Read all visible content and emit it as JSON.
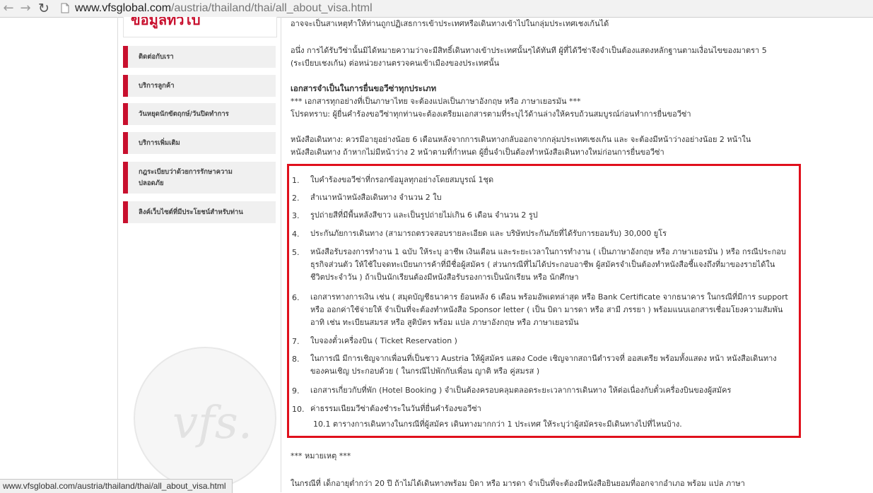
{
  "browser": {
    "url_host": "www.vfsglobal.com",
    "url_path": "/austria/thailand/thai/all_about_visa.html",
    "status_url": "www.vfsglobal.com/austria/thailand/thai/all_about_visa.html"
  },
  "sidebar": {
    "header": "ข้อมูลทั่วไป",
    "items": [
      {
        "label": "ติดต่อกับเรา"
      },
      {
        "label": "บริการลูกค้า"
      },
      {
        "label": "วันหยุดนักขัตฤกษ์/วันปิดทำการ"
      },
      {
        "label": "บริการเพิ่มเติม"
      },
      {
        "label_line1": "กฎระเบียบว่าด้วยการรักษาความ",
        "label_line2": "ปลอดภัย"
      },
      {
        "label": "ลิงค์เว็บไซต์ที่มีประโยชน์สำหรับท่าน"
      }
    ],
    "watermark": "vfs."
  },
  "main": {
    "top_line": "อาจจะเป็นสาเหตุทำให้ท่านถูกปฏิเสธการเข้าประเทศหรือเดินทางเข้าไปในกลุ่มประเทศเชงเก้นได้",
    "para1_line1": "อนึ่ง การได้รับวีซ่านั้นมิได้หมายความว่าจะมีสิทธิ์เดินทางเข้าประเทศนั้นๆได้ทันที ผู้ที่ได้วีซ่าจึงจำเป็นต้องแสดงหลักฐานตามเงื่อนไขของมาตรา 5",
    "para1_line2": "(ระเบียบเชงเก้น) ต่อหน่วยงานตรวจคนเข้าเมืองของประเทศนั้น",
    "section_title": "เอกสารจำเป็นในการยื่นขอวีซ่าทุกประเภท",
    "note_line1": "*** เอกสารทุกอย่างที่เป็นภาษาไทย จะต้องแปลเป็นภาษาอังกฤษ หรือ ภาษาเยอรมัน ***",
    "note_line2": "โปรดทราบ: ผู้ยื่นคำร้องขอวีซ่าทุกท่านจะต้องเตรียมเอกสารตามที่ระบุไว้ด้านล่างให้ครบถ้วนสมบูรณ์ก่อนทำการยื่นขอวีซ่า",
    "passport_line1": "หนังสือเดินทาง: ควรมีอายุอย่างน้อย 6 เดือนหลังจากการเดินทางกลับออกจากกลุ่มประเทศเชงเก้น และ จะต้องมีหน้าว่างอย่างน้อย 2 หน้าใน",
    "passport_line2": "หนังสือเดินทาง ถ้าหากไม่มีหน้าว่าง 2 หน้าตามที่กำหนด ผู้ยื่นจำเป็นต้องทำหนังสือเดินทางใหม่ก่อนการยื่นขอวีซ่า",
    "list": [
      {
        "num": "1.",
        "lines": [
          "ใบคำร้องขอวีซ่าที่กรอกข้อมูลทุกอย่างโดยสมบูรณ์ 1ชุด"
        ]
      },
      {
        "num": "2.",
        "lines": [
          "สำเนาหน้าหนังสือเดินทาง จำนวน 2 ใบ"
        ]
      },
      {
        "num": "3.",
        "lines": [
          "รูปถ่ายสีที่มีพื้นหลังสีขาว และเป็นรูปถ่ายไม่เกิน 6 เดือน จำนวน 2 รูป"
        ]
      },
      {
        "num": "4.",
        "lines": [
          "ประกันภัยการเดินทาง (สามารถตรวจสอบรายละเอียด และ บริษัทประกันภัยที่ได้รับการยอมรับ) 30,000 ยูโร"
        ]
      },
      {
        "num": "5.",
        "lines": [
          "หนังสือรับรองการทำงาน 1 ฉบับ ให้ระบุ อาชีพ เงินเดือน และระยะเวลาในการทำงาน ( เป็นภาษาอังกฤษ หรือ ภาษาเยอรมัน ) หรือ กรณีประกอบ",
          "ธุรกิจส่วนตัว ให้ใช้ใบจดทะเบียนการค้าที่มีชื่อผู้สมัคร ( ส่วนกรณีที่ไม่ได้ประกอบอาชีพ ผู้สมัครจำเป็นต้องทำหนังสือชี้แจงถึงที่มาของรายได้ใน",
          "ชีวิตประจำวัน ) ถ้าเป็นนักเรียนต้องมีหนังสือรับรองการเป็นนักเรียน หรือ นักศึกษา"
        ]
      },
      {
        "num": "6.",
        "lines": [
          "เอกสารทางการเงิน เช่น ( สมุดบัญชีธนาคาร ย้อนหลัง 6 เดือน พร้อมอัพเดทล่าสุด หรือ Bank Certificate จากธนาคาร ในกรณีที่มีการ support",
          "หรือ ออกค่าใช้จ่ายให้ จำเป็นที่จะต้องทำหนังสือ Sponsor letter ( เป็น บิดา มารดา หรือ สามี ภรรยา ) พร้อมแนบเอกสารเชื่อมโยงความสัมพัน",
          "อาทิ เช่น ทะเบียนสมรส หรือ สูติบัตร พร้อม แปล ภาษาอังกฤษ หรือ ภาษาเยอรมัน"
        ]
      },
      {
        "num": "7.",
        "lines": [
          "ใบจองตั๋วเครื่องบิน ( Ticket Reservation )"
        ]
      },
      {
        "num": "8.",
        "lines": [
          "ในการณี มีการเชิญจากเพื่อนที่เป็นชาว Austria ให้ผู้สมัคร แสดง Code เชิญจากสถานีตำรวจที่ ออสเตรีย พร้อมทั้งแสดง หน้า หนังสือเดินทาง",
          "ของคนเชิญ ประกอบด้วย ( ในกรณีไปพักกับเพื่อน ญาติ หรือ คู่สมรส )"
        ]
      },
      {
        "num": "9.",
        "lines": [
          "เอกสารเกี่ยวกับที่พัก (Hotel Booking ) จำเป็นต้องครอบคลุมตลอดระยะเวลาการเดินทาง ให้ต่อเนื่องกับตั๋วเครื่องบินของผู้สมัคร"
        ]
      },
      {
        "num": "10.",
        "lines": [
          "ค่าธรรมเนียมวีซ่าต้องชำระในวันที่ยื่นคำร้องขอวีซ่า"
        ]
      }
    ],
    "sub_item": "10.1   ตารางการเดินทางในกรณีที่ผู้สมัคร เดินทางมากกว่า 1 ประเทศ ให้ระบุว่าผู้สมัครจะมีเดินทางไปที่ไหนบ้าง.",
    "remark_title": "*** หมายเหตุ ***",
    "remark_line": "ในกรณีที่ เด็กอายุต่ำกว่า 20 ปี ถ้าไม่ได้เดินทางพร้อม บิดา หรือ มารดา จำเป็นที่จะต้องมีหนังสือยินยอมที่ออกจากอำเภอ พร้อม แปล ภาษา"
  },
  "colors": {
    "accent": "#c8102e",
    "highlight_box": "#e0101c"
  }
}
